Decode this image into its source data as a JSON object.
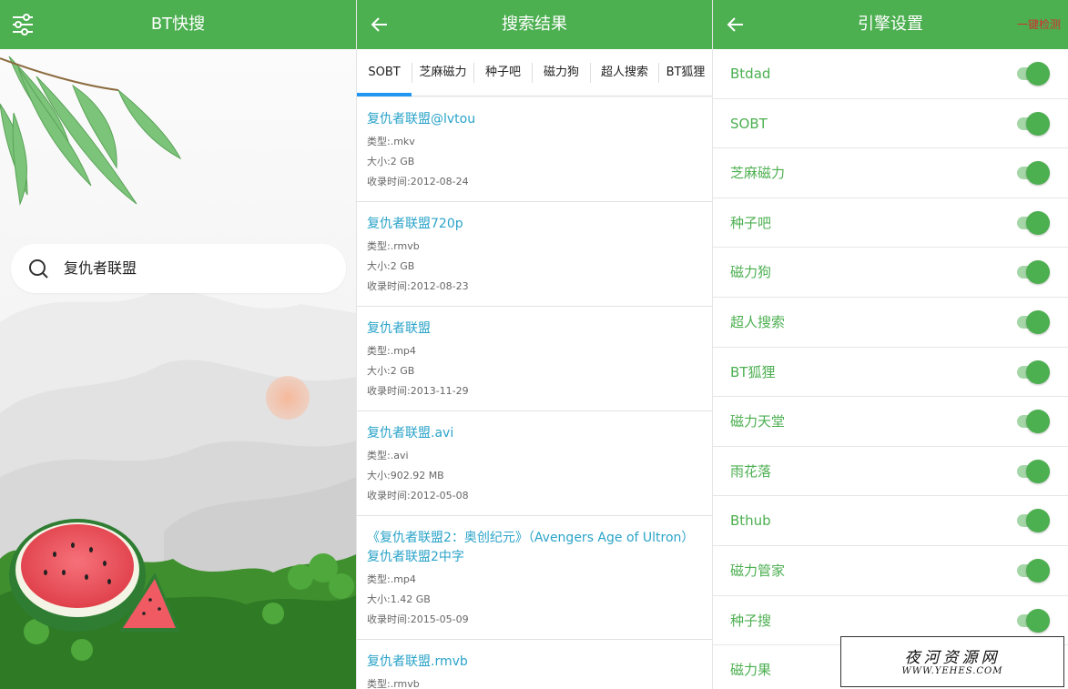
{
  "panel1": {
    "title": "BT快搜",
    "menu_icon": "sliders-icon",
    "search": {
      "icon": "search-icon",
      "value": "复仇者联盟"
    }
  },
  "panel2": {
    "title": "搜索结果",
    "back_icon": "arrow-left-icon",
    "tabs": [
      {
        "label": "SOBT",
        "active": true
      },
      {
        "label": "芝麻磁力"
      },
      {
        "label": "种子吧"
      },
      {
        "label": "磁力狗"
      },
      {
        "label": "超人搜索"
      },
      {
        "label": "BT狐狸"
      }
    ],
    "results": [
      {
        "title": "复仇者联盟@lvtou",
        "type": "类型:.mkv",
        "size": "大小:2 GB",
        "time": "收录时间:2012-08-24"
      },
      {
        "title": "复仇者联盟720p",
        "type": "类型:.rmvb",
        "size": "大小:2 GB",
        "time": "收录时间:2012-08-23"
      },
      {
        "title": "复仇者联盟",
        "type": "类型:.mp4",
        "size": "大小:2 GB",
        "time": "收录时间:2013-11-29"
      },
      {
        "title": "复仇者联盟.avi",
        "type": "类型:.avi",
        "size": "大小:902.92 MB",
        "time": "收录时间:2012-05-08"
      },
      {
        "title": "《复仇者联盟2：奥创纪元》（Avengers Age of Ultron）复仇者联盟2中字",
        "type": "类型:.mp4",
        "size": "大小:1.42 GB",
        "time": "收录时间:2015-05-09"
      },
      {
        "title": "复仇者联盟.rmvb",
        "type": "类型:.rmvb",
        "size": "",
        "time": ""
      }
    ]
  },
  "panel3": {
    "title": "引擎设置",
    "back_icon": "arrow-left-icon",
    "action": "一键检测",
    "engines": [
      {
        "name": "Btdad",
        "on": true
      },
      {
        "name": "SOBT",
        "on": true
      },
      {
        "name": "芝麻磁力",
        "on": true
      },
      {
        "name": "种子吧",
        "on": true
      },
      {
        "name": "磁力狗",
        "on": true
      },
      {
        "name": "超人搜索",
        "on": true
      },
      {
        "name": "BT狐狸",
        "on": true
      },
      {
        "name": "磁力天堂",
        "on": true
      },
      {
        "name": "雨花落",
        "on": true
      },
      {
        "name": "Bthub",
        "on": true
      },
      {
        "name": "磁力管家",
        "on": true
      },
      {
        "name": "种子搜",
        "on": true
      },
      {
        "name": "磁力果",
        "on": true
      }
    ]
  },
  "watermark": {
    "line1": "夜河资源网",
    "line2": "WWW.YEHES.COM"
  },
  "colors": {
    "primary": "#4caf50",
    "link": "#2aa3c8",
    "tab_indicator": "#2196f3",
    "action": "#d32f2f"
  }
}
